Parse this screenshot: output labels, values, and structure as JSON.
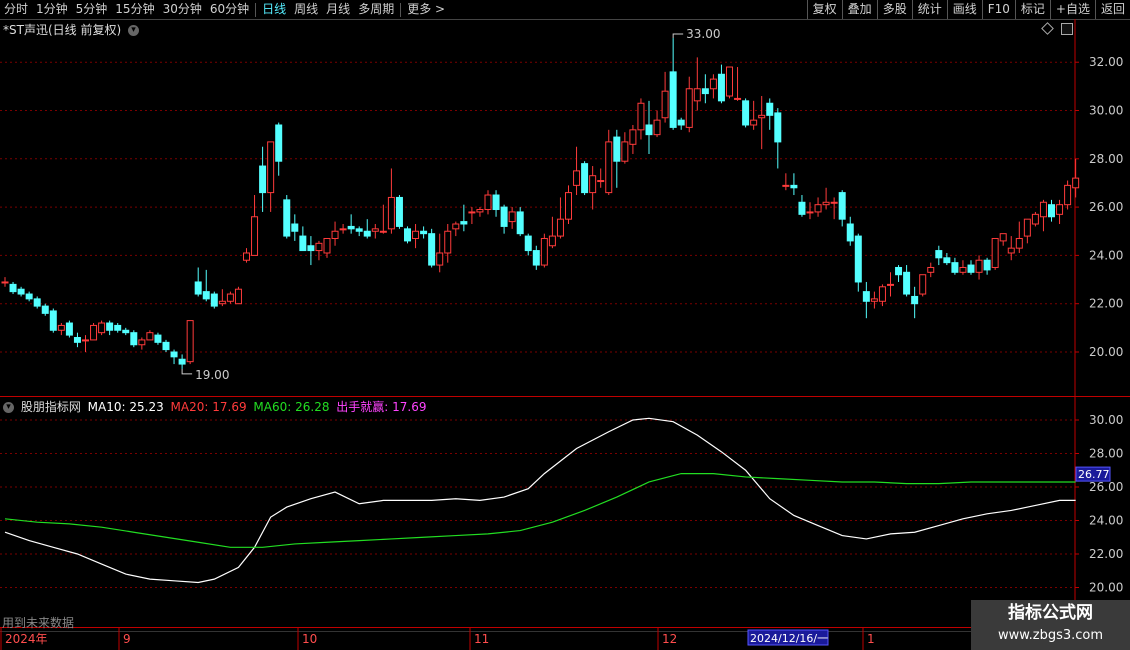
{
  "toolbar": {
    "left": [
      "分时",
      "1分钟",
      "5分钟",
      "15分钟",
      "30分钟",
      "60分钟",
      "日线",
      "周线",
      "月线",
      "多周期",
      "更多 >"
    ],
    "active": "日线",
    "right": [
      "复权",
      "叠加",
      "多股",
      "统计",
      "画线",
      "F10",
      "标记",
      "+自选",
      "返回"
    ]
  },
  "title": "*ST声迅(日线 前复权)",
  "colors": {
    "up": "#ff3b3b",
    "down": "#54ffff",
    "grid": "#7a0000",
    "ma10": "#ffffff",
    "ma60": "#22dd22",
    "ma20": "#ff3b3b",
    "signal": "#ff44ff",
    "axis": "#c00000"
  },
  "chart_data": [
    {
      "type": "candlestick",
      "title": "*ST声迅(日线 前复权)",
      "yticks": [
        "20.00",
        "22.00",
        "24.00",
        "26.00",
        "28.00",
        "30.00",
        "32.00"
      ],
      "ylim": [
        18.5,
        33.5
      ],
      "annotations": {
        "high": "33.00",
        "low": "19.00"
      },
      "ohlc": [
        [
          22.9,
          23.1,
          22.7,
          22.9
        ],
        [
          22.8,
          22.9,
          22.4,
          22.5
        ],
        [
          22.6,
          22.7,
          22.3,
          22.4
        ],
        [
          22.4,
          22.5,
          22.1,
          22.2
        ],
        [
          22.2,
          22.3,
          21.8,
          21.9
        ],
        [
          21.9,
          22.0,
          21.5,
          21.6
        ],
        [
          21.7,
          21.8,
          20.8,
          20.9
        ],
        [
          20.9,
          21.2,
          20.7,
          21.1
        ],
        [
          21.2,
          21.3,
          20.6,
          20.7
        ],
        [
          20.6,
          20.8,
          20.2,
          20.4
        ],
        [
          20.5,
          20.7,
          20.0,
          20.5
        ],
        [
          20.5,
          21.2,
          20.5,
          21.1
        ],
        [
          20.8,
          21.3,
          20.7,
          21.2
        ],
        [
          21.2,
          21.3,
          20.7,
          20.9
        ],
        [
          21.1,
          21.2,
          20.8,
          20.9
        ],
        [
          20.9,
          21.0,
          20.7,
          20.8
        ],
        [
          20.8,
          20.9,
          20.2,
          20.3
        ],
        [
          20.3,
          20.6,
          20.1,
          20.5
        ],
        [
          20.5,
          20.9,
          20.5,
          20.8
        ],
        [
          20.7,
          20.8,
          20.3,
          20.4
        ],
        [
          20.4,
          20.5,
          20.0,
          20.1
        ],
        [
          20.0,
          20.1,
          19.5,
          19.8
        ],
        [
          19.7,
          19.9,
          19.3,
          19.5
        ],
        [
          19.6,
          21.3,
          19.5,
          21.3
        ],
        [
          22.9,
          23.5,
          22.3,
          22.4
        ],
        [
          22.5,
          23.4,
          22.1,
          22.2
        ],
        [
          22.4,
          22.5,
          21.8,
          21.9
        ],
        [
          22.0,
          22.6,
          21.9,
          22.1
        ],
        [
          22.1,
          22.5,
          22.0,
          22.4
        ],
        [
          22.0,
          22.7,
          22.0,
          22.6
        ],
        [
          23.8,
          24.3,
          23.7,
          24.1
        ],
        [
          24.0,
          26.5,
          24.0,
          25.6
        ],
        [
          27.7,
          28.5,
          25.8,
          26.6
        ],
        [
          26.6,
          28.7,
          25.8,
          28.7
        ],
        [
          29.4,
          29.5,
          27.3,
          27.9
        ],
        [
          26.3,
          26.5,
          24.7,
          24.8
        ],
        [
          25.3,
          25.7,
          24.6,
          25.0
        ],
        [
          24.8,
          25.2,
          24.2,
          24.2
        ],
        [
          24.4,
          24.8,
          23.6,
          24.2
        ],
        [
          24.2,
          24.6,
          23.8,
          24.5
        ],
        [
          24.1,
          24.7,
          23.9,
          24.7
        ],
        [
          24.7,
          25.4,
          24.4,
          25.0
        ],
        [
          25.1,
          25.3,
          24.9,
          25.1
        ],
        [
          25.2,
          25.7,
          24.9,
          25.1
        ],
        [
          25.1,
          25.2,
          24.8,
          25.0
        ],
        [
          25.0,
          25.5,
          24.7,
          24.8
        ],
        [
          25.0,
          25.3,
          24.7,
          25.1
        ],
        [
          25.0,
          26.1,
          24.9,
          25.0
        ],
        [
          25.1,
          27.6,
          24.9,
          26.4
        ],
        [
          26.4,
          26.5,
          25.1,
          25.2
        ],
        [
          25.1,
          25.2,
          24.5,
          24.6
        ],
        [
          24.7,
          25.3,
          24.3,
          25.0
        ],
        [
          25.0,
          25.2,
          24.7,
          24.9
        ],
        [
          24.9,
          25.1,
          23.5,
          23.6
        ],
        [
          23.6,
          24.9,
          23.3,
          24.1
        ],
        [
          24.1,
          25.3,
          23.7,
          25.0
        ],
        [
          25.1,
          25.4,
          24.8,
          25.3
        ],
        [
          25.4,
          26.1,
          25.0,
          25.3
        ],
        [
          25.8,
          26.0,
          25.3,
          25.8
        ],
        [
          25.8,
          26.0,
          25.6,
          25.9
        ],
        [
          25.9,
          26.7,
          25.7,
          26.5
        ],
        [
          26.5,
          26.7,
          25.6,
          25.9
        ],
        [
          26.0,
          26.1,
          24.9,
          25.2
        ],
        [
          25.4,
          26.0,
          25.1,
          25.8
        ],
        [
          25.8,
          26.0,
          24.8,
          24.9
        ],
        [
          24.8,
          24.9,
          24.0,
          24.2
        ],
        [
          24.2,
          24.4,
          23.4,
          23.6
        ],
        [
          23.6,
          24.9,
          23.5,
          24.7
        ],
        [
          24.4,
          25.6,
          24.3,
          24.8
        ],
        [
          24.8,
          26.4,
          24.7,
          25.5
        ],
        [
          25.5,
          26.9,
          25.3,
          26.6
        ],
        [
          26.9,
          28.5,
          26.5,
          27.5
        ],
        [
          27.8,
          27.9,
          26.5,
          26.6
        ],
        [
          26.6,
          27.7,
          25.9,
          27.3
        ],
        [
          27.1,
          27.6,
          26.8,
          27.1
        ],
        [
          26.6,
          29.2,
          26.5,
          28.7
        ],
        [
          28.9,
          29.2,
          26.8,
          27.9
        ],
        [
          27.9,
          29.1,
          27.8,
          28.7
        ],
        [
          28.6,
          29.4,
          28.2,
          29.2
        ],
        [
          29.2,
          30.5,
          28.8,
          30.3
        ],
        [
          29.4,
          30.4,
          28.2,
          29.0
        ],
        [
          29.0,
          30.0,
          28.9,
          29.6
        ],
        [
          29.7,
          31.6,
          29.5,
          30.8
        ],
        [
          31.6,
          33.0,
          29.2,
          29.3
        ],
        [
          29.6,
          29.7,
          29.2,
          29.4
        ],
        [
          29.3,
          31.4,
          29.1,
          30.9
        ],
        [
          30.4,
          32.2,
          30.0,
          30.9
        ],
        [
          30.9,
          31.5,
          30.3,
          30.7
        ],
        [
          30.9,
          31.5,
          30.5,
          31.3
        ],
        [
          31.5,
          31.9,
          30.3,
          30.4
        ],
        [
          30.6,
          31.5,
          30.5,
          31.8
        ],
        [
          30.5,
          31.8,
          30.4,
          30.5
        ],
        [
          30.4,
          30.5,
          29.3,
          29.4
        ],
        [
          29.4,
          30.4,
          29.2,
          29.6
        ],
        [
          29.7,
          30.6,
          28.4,
          29.8
        ],
        [
          30.3,
          30.5,
          29.2,
          29.8
        ],
        [
          29.9,
          30.1,
          27.6,
          28.7
        ],
        [
          26.9,
          27.4,
          26.7,
          26.9
        ],
        [
          26.9,
          27.4,
          26.5,
          26.8
        ],
        [
          26.2,
          26.5,
          25.6,
          25.7
        ],
        [
          25.8,
          26.2,
          25.5,
          25.8
        ],
        [
          25.8,
          26.4,
          25.6,
          26.1
        ],
        [
          26.1,
          26.8,
          25.9,
          26.2
        ],
        [
          26.2,
          26.4,
          25.5,
          26.2
        ],
        [
          26.6,
          26.7,
          25.2,
          25.5
        ],
        [
          25.3,
          25.6,
          24.4,
          24.6
        ],
        [
          24.8,
          24.9,
          22.5,
          22.9
        ],
        [
          22.5,
          22.9,
          21.4,
          22.1
        ],
        [
          22.1,
          22.5,
          21.8,
          22.2
        ],
        [
          22.1,
          22.8,
          21.9,
          22.7
        ],
        [
          22.8,
          23.3,
          22.3,
          22.8
        ],
        [
          23.5,
          23.6,
          22.9,
          23.2
        ],
        [
          23.3,
          23.6,
          22.3,
          22.4
        ],
        [
          22.3,
          22.7,
          21.4,
          22.0
        ],
        [
          22.4,
          23.2,
          22.3,
          23.2
        ],
        [
          23.3,
          23.7,
          23.1,
          23.5
        ],
        [
          24.2,
          24.4,
          23.6,
          23.9
        ],
        [
          23.9,
          24.1,
          23.6,
          23.7
        ],
        [
          23.7,
          23.9,
          23.2,
          23.3
        ],
        [
          23.3,
          23.8,
          23.2,
          23.5
        ],
        [
          23.6,
          23.8,
          23.2,
          23.3
        ],
        [
          23.3,
          24.0,
          23.0,
          23.8
        ],
        [
          23.8,
          23.9,
          23.2,
          23.4
        ],
        [
          23.5,
          24.6,
          23.4,
          24.7
        ],
        [
          24.6,
          24.9,
          24.4,
          24.9
        ],
        [
          24.1,
          24.8,
          23.8,
          24.3
        ],
        [
          24.3,
          25.4,
          24.1,
          24.7
        ],
        [
          24.8,
          25.5,
          24.5,
          25.5
        ],
        [
          25.3,
          25.8,
          25.2,
          25.7
        ],
        [
          25.6,
          26.3,
          25.0,
          26.2
        ],
        [
          26.1,
          26.3,
          25.4,
          25.6
        ],
        [
          25.7,
          26.3,
          25.3,
          26.1
        ],
        [
          26.1,
          27.1,
          25.9,
          26.9
        ],
        [
          26.8,
          28.0,
          26.4,
          27.2
        ]
      ]
    },
    {
      "type": "line",
      "indicator": "股朋指标网",
      "legend": [
        {
          "label": "MA10: 25.23",
          "color": "#ffffff"
        },
        {
          "label": "MA20: 17.69",
          "color": "#ff3b3b"
        },
        {
          "label": "MA60: 26.28",
          "color": "#22dd22"
        },
        {
          "label": "出手就赢: 17.69",
          "color": "#ff44ff"
        }
      ],
      "yticks": [
        "20.00",
        "22.00",
        "24.00",
        "26.00",
        "28.00",
        "30.00"
      ],
      "ylim": [
        19.2,
        31.0
      ],
      "current_value": "26.77",
      "series": [
        {
          "name": "MA10",
          "color": "#ffffff",
          "x": [
            0,
            3,
            6,
            9,
            12,
            15,
            18,
            21,
            24,
            26,
            29,
            31,
            33,
            35,
            38,
            41,
            44,
            47,
            50,
            53,
            56,
            59,
            62,
            65,
            67,
            71,
            75,
            78,
            80,
            83,
            86,
            89,
            92,
            95,
            98,
            101,
            104,
            107,
            110,
            113,
            116,
            119,
            122,
            125,
            128,
            131,
            133
          ],
          "values": [
            23.3,
            22.8,
            22.4,
            22.0,
            21.4,
            20.8,
            20.5,
            20.4,
            20.3,
            20.5,
            21.2,
            22.4,
            24.2,
            24.8,
            25.3,
            25.7,
            25.0,
            25.2,
            25.2,
            25.2,
            25.3,
            25.2,
            25.4,
            25.9,
            26.8,
            28.3,
            29.3,
            30.0,
            30.1,
            29.9,
            29.1,
            28.1,
            27.0,
            25.3,
            24.3,
            23.7,
            23.1,
            22.9,
            23.2,
            23.3,
            23.7,
            24.1,
            24.4,
            24.6,
            24.9,
            25.2,
            25.2
          ]
        },
        {
          "name": "MA60",
          "color": "#22dd22",
          "x": [
            0,
            4,
            8,
            12,
            16,
            20,
            24,
            28,
            32,
            36,
            40,
            44,
            48,
            52,
            56,
            60,
            64,
            68,
            72,
            76,
            80,
            84,
            88,
            92,
            96,
            100,
            104,
            108,
            112,
            116,
            120,
            124,
            128,
            133
          ],
          "values": [
            24.1,
            23.9,
            23.8,
            23.6,
            23.3,
            23.0,
            22.7,
            22.4,
            22.4,
            22.6,
            22.7,
            22.8,
            22.9,
            23.0,
            23.1,
            23.2,
            23.4,
            23.9,
            24.6,
            25.4,
            26.3,
            26.8,
            26.8,
            26.6,
            26.5,
            26.4,
            26.3,
            26.3,
            26.2,
            26.2,
            26.3,
            26.3,
            26.3,
            26.3
          ]
        }
      ]
    }
  ],
  "xaxis": {
    "labels": [
      {
        "t": "2024年",
        "x": 5
      },
      {
        "t": "9",
        "x": 123
      },
      {
        "t": "10",
        "x": 302
      },
      {
        "t": "11",
        "x": 474
      },
      {
        "t": "12",
        "x": 662
      },
      {
        "t": "1",
        "x": 867
      }
    ],
    "cursor_date": "2024/12/16/一"
  },
  "note": "用到未来数据",
  "watermark": {
    "line1": "指标公式网",
    "line2": "www.zbgs3.com"
  }
}
